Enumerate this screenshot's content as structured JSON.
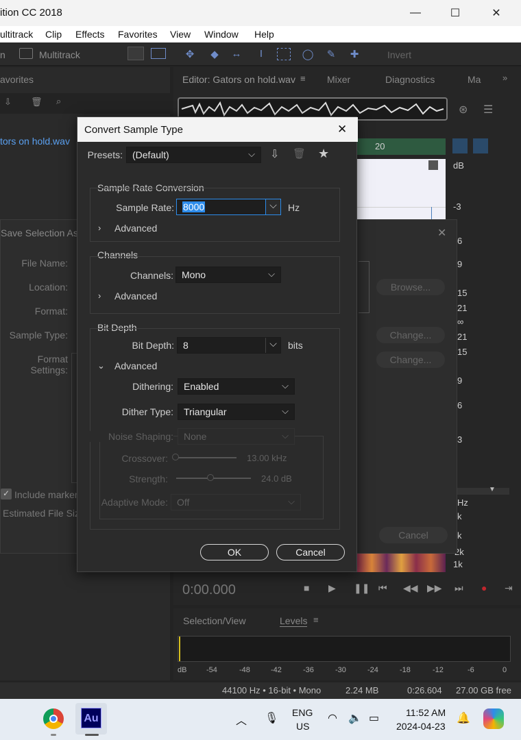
{
  "window": {
    "title": "ition CC 2018",
    "minimize": "—",
    "maximize": "☐",
    "close": "✕"
  },
  "menu": [
    "ultitrack",
    "Clip",
    "Effects",
    "Favorites",
    "View",
    "Window",
    "Help"
  ],
  "toolbar": {
    "waveform_tab": "n",
    "multitrack_label": "Multitrack",
    "invert_label": "Invert"
  },
  "left_panel": {
    "title": "avorites",
    "file_item": "tors on hold.wav"
  },
  "editor": {
    "tab_editor": "Editor: Gators on hold.wav",
    "tab_mixer": "Mixer",
    "tab_diagnostics": "Diagnostics",
    "tab_more": "Ma",
    "ruler_label": "20",
    "db_labels": [
      "dB",
      "-3",
      "6",
      "9",
      "15",
      "21",
      "∞",
      "21",
      "15",
      "9",
      "6",
      "3"
    ],
    "hz_labels": [
      "Hz",
      "k",
      "k",
      "2k",
      "1k"
    ],
    "time": "0:00.000"
  },
  "levels": {
    "tab_selection": "Selection/View",
    "tab_levels": "Levels",
    "scale": [
      "dB",
      "-54",
      "-48",
      "-42",
      "-36",
      "-30",
      "-24",
      "-18",
      "-12",
      "-6",
      "0"
    ]
  },
  "status": {
    "format": "44100 Hz • 16-bit • Mono",
    "size": "2.24 MB",
    "duration": "0:26.604",
    "free": "27.00 GB free"
  },
  "save_dialog": {
    "title": "Save Selection As",
    "file_name": "File Name:",
    "location": "Location:",
    "format": "Format:",
    "sample_type": "Sample Type:",
    "format_settings": "Format Settings:",
    "browse": "Browse...",
    "change1": "Change...",
    "change2": "Change...",
    "include_markers": "Include marker",
    "estimated_size": "Estimated File Siz",
    "cancel": "Cancel"
  },
  "convert_dialog": {
    "title": "Convert Sample Type",
    "presets_label": "Presets:",
    "presets_value": "(Default)",
    "src_group": "Sample Rate Conversion",
    "sample_rate_label": "Sample Rate:",
    "sample_rate_value": "8000",
    "sample_rate_unit": "Hz",
    "advanced1": "Advanced",
    "channels_group": "Channels",
    "channels_label": "Channels:",
    "channels_value": "Mono",
    "advanced2": "Advanced",
    "bitdepth_group": "Bit Depth",
    "bitdepth_label": "Bit Depth:",
    "bitdepth_value": "8",
    "bitdepth_unit": "bits",
    "advanced3": "Advanced",
    "dithering_label": "Dithering:",
    "dithering_value": "Enabled",
    "dither_type_label": "Dither Type:",
    "dither_type_value": "Triangular",
    "noise_shaping_label": "Noise Shaping:",
    "noise_shaping_value": "None",
    "crossover_label": "Crossover:",
    "crossover_value": "13.00 kHz",
    "strength_label": "Strength:",
    "strength_value": "24.0 dB",
    "adaptive_label": "Adaptive Mode:",
    "adaptive_value": "Off",
    "ok": "OK",
    "cancel": "Cancel"
  },
  "taskbar": {
    "lang_top": "ENG",
    "lang_bottom": "US",
    "time": "11:52 AM",
    "date": "2024-04-23",
    "au_label": "Au"
  },
  "colors": {
    "accent": "#2d8ceb",
    "au_app": "#00005b",
    "au_text": "#9999ff",
    "selection": "#4a7ebb"
  }
}
